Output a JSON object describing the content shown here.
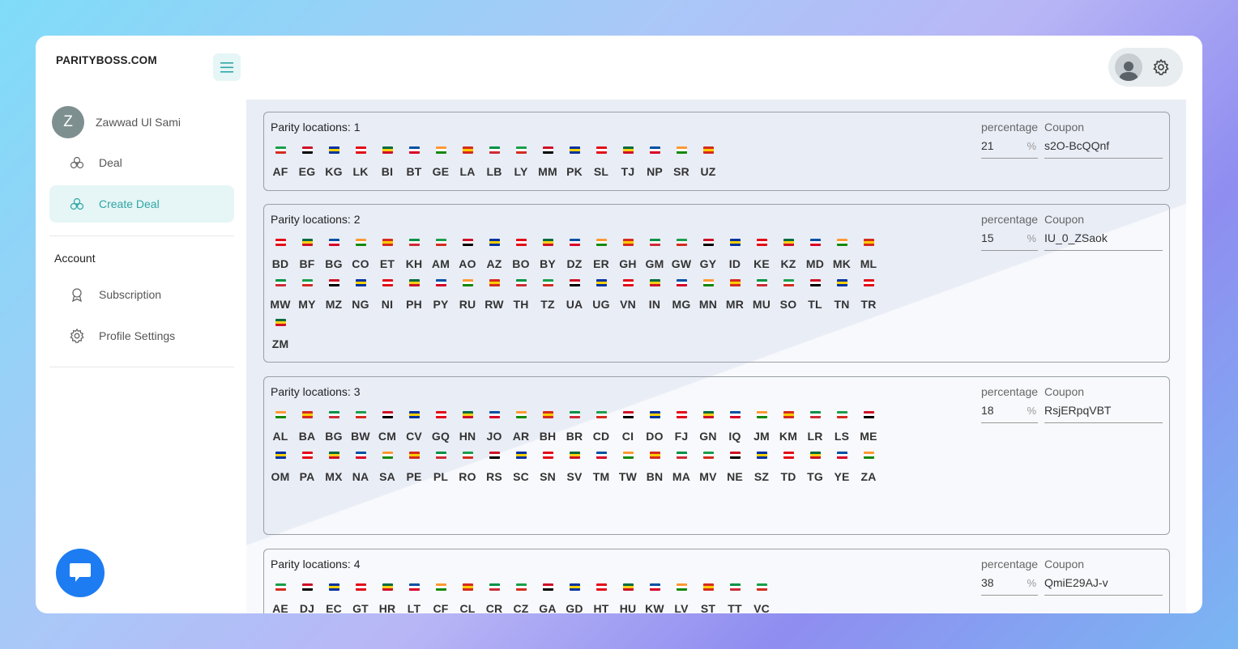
{
  "brand": "PARITYBOSS.COM",
  "user": {
    "initial": "Z",
    "name": "Zawwad Ul Sami"
  },
  "nav": {
    "deal": "Deal",
    "create_deal": "Create Deal",
    "account_section": "Account",
    "subscription": "Subscription",
    "profile_settings": "Profile Settings"
  },
  "colors": {
    "accent": "#2ea6a6",
    "fab": "#1d7cf2",
    "avatar": "#7e8f90"
  },
  "labels": {
    "percentage": "percentage",
    "coupon": "Coupon",
    "unit": "%"
  },
  "cards": [
    {
      "title": "Parity locations: 1",
      "percentage": "21",
      "coupon": "s2O-BcQQnf",
      "countries": [
        "AF",
        "EG",
        "KG",
        "LK",
        "BI",
        "BT",
        "GE",
        "LA",
        "LB",
        "LY",
        "MM",
        "PK",
        "SL",
        "TJ",
        "NP",
        "SR",
        "UZ"
      ]
    },
    {
      "title": "Parity locations: 2",
      "percentage": "15",
      "coupon": "IU_0_ZSaok",
      "countries": [
        "BD",
        "BF",
        "BG",
        "CO",
        "ET",
        "KH",
        "AM",
        "AO",
        "AZ",
        "BO",
        "BY",
        "DZ",
        "ER",
        "GH",
        "GM",
        "GW",
        "GY",
        "ID",
        "KE",
        "KZ",
        "MD",
        "MK",
        "ML",
        "MW",
        "MY",
        "MZ",
        "NG",
        "NI",
        "PH",
        "PY",
        "RU",
        "RW",
        "TH",
        "TZ",
        "UA",
        "UG",
        "VN",
        "IN",
        "MG",
        "MN",
        "MR",
        "MU",
        "SO",
        "TL",
        "TN",
        "TR",
        "ZM"
      ]
    },
    {
      "title": "Parity locations: 3",
      "percentage": "18",
      "coupon": "RsjERpqVBT",
      "countries": [
        "AL",
        "BA",
        "BG",
        "BW",
        "CM",
        "CV",
        "GQ",
        "HN",
        "JO",
        "AR",
        "BH",
        "BR",
        "CD",
        "CI",
        "DO",
        "FJ",
        "GN",
        "IQ",
        "JM",
        "KM",
        "LR",
        "LS",
        "ME",
        "OM",
        "PA",
        "MX",
        "NA",
        "SA",
        "PE",
        "PL",
        "RO",
        "RS",
        "SC",
        "SN",
        "SV",
        "TM",
        "TW",
        "BN",
        "MA",
        "MV",
        "NE",
        "SZ",
        "TD",
        "TG",
        "YE",
        "ZA"
      ]
    },
    {
      "title": "Parity locations: 4",
      "percentage": "38",
      "coupon": "QmiE29AJ-v",
      "countries": [
        "AE",
        "DJ",
        "EC",
        "GT",
        "HR",
        "LT",
        "CF",
        "CL",
        "CR",
        "CZ",
        "GA",
        "GD",
        "HT",
        "HU",
        "KW",
        "LV",
        "ST",
        "TT",
        "VC"
      ]
    }
  ]
}
